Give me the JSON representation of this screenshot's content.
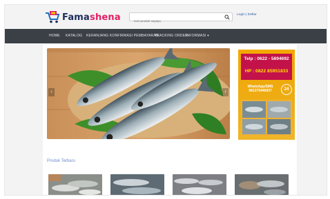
{
  "brand": {
    "name_part1": "Fama",
    "name_part2": "shena",
    "accent": "#e31e64",
    "primary": "#1e2c5a"
  },
  "search": {
    "placeholder": "Cari produk sayaya",
    "icon": "search-icon"
  },
  "header": {
    "auth_label": "Login | Daftar"
  },
  "nav": {
    "background": "#3b3f46",
    "items": [
      {
        "label": "HOME"
      },
      {
        "label": "KATALOG"
      },
      {
        "label": "KERANJANG"
      },
      {
        "label": "KONFIRMASI PEMBAYARAN"
      },
      {
        "label": "TRACKING ORDER"
      },
      {
        "label": "INFORMASI ▾"
      }
    ]
  },
  "promo": {
    "tel": "Telp : 0622 - 5894692",
    "hp": "HP : 0822 85951833",
    "wa_line1": "WhatsApp/SMS",
    "wa_line2": "081375446837",
    "badge": "24",
    "background": "#f2a700",
    "box_color": "#c3124a"
  },
  "carousel": {
    "prev_icon": "chevron-left-icon",
    "next_icon": "chevron-right-icon",
    "prev_glyph": "‹",
    "next_glyph": "›"
  },
  "section": {
    "title": "Produk Terbaru"
  },
  "products": [
    {
      "image": "fish-product-image-1"
    },
    {
      "image": "fish-product-image-2"
    },
    {
      "image": "fish-product-image-3"
    },
    {
      "image": "fish-product-image-4"
    }
  ]
}
